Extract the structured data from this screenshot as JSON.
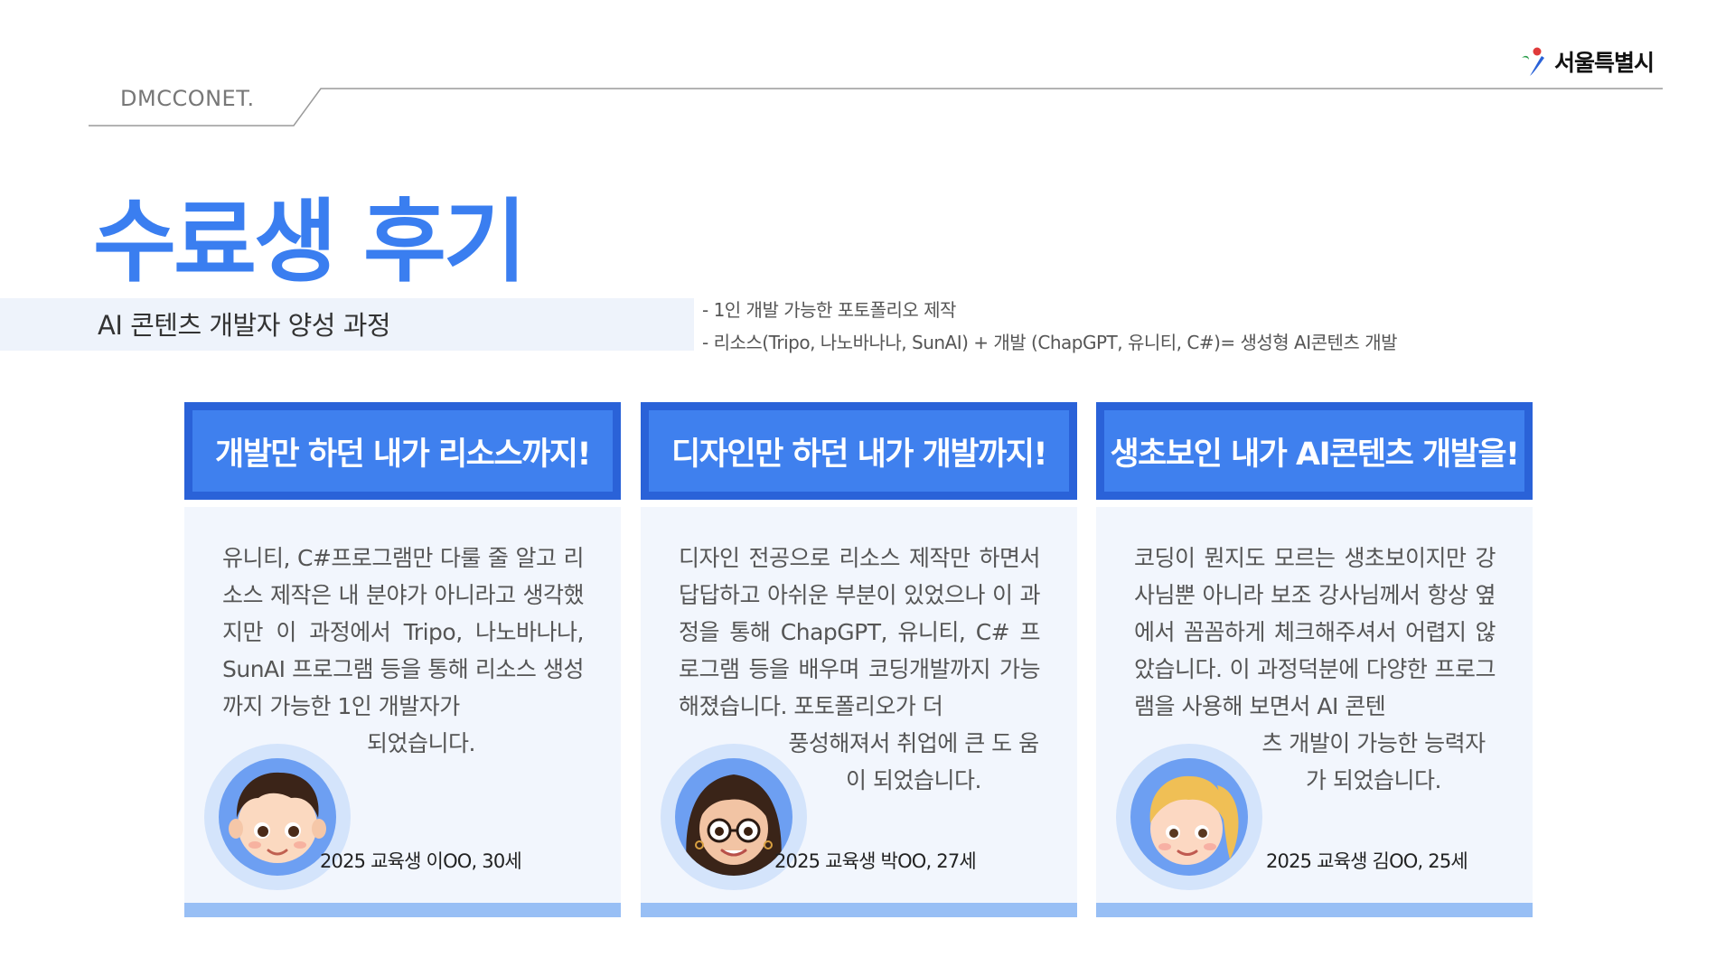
{
  "header": {
    "brand": "DMCCONET.",
    "logo_text": "서울특별시"
  },
  "title": "수료생 후기",
  "subtitle": "AI 콘텐츠 개발자 양성 과정",
  "description": [
    "- 1인 개발 가능한 포토폴리오 제작",
    "- 리소스(Tripo, 나노바나나, SunAI) + 개발 (ChapGPT, 유니티, C#)= 생성형 AI콘텐츠 개발"
  ],
  "cards": [
    {
      "heading": "개발만 하던 내가 리소스까지!",
      "review": "유니티, C#프로그램만 다룰 줄 알고 리소스 제작은 내 분야가 아니라고 생각했지만 이 과정에서 Tripo, 나노바나나, SunAI 프로그램 등을 통해 리소스 생성까지 가능한 1인 개발자가",
      "review_tail": "되었습니다.",
      "caption": "2025  교육생 이OO, 30세",
      "avatar": "boy-avatar-icon"
    },
    {
      "heading": "디자인만 하던 내가 개발까지!",
      "review": "디자인 전공으로 리소스 제작만 하면서 답답하고 아쉬운 부분이 있었으나 이 과정을 통해  ChapGPT, 유니티, C# 프로그램 등을 배우며 코딩개발까지 가능해졌습니다. 포토폴리오가 더",
      "review_tail": "풍성해져서 취업에 큰 도 움이 되었습니다.",
      "caption": "2025   교육생 박OO, 27세",
      "avatar": "woman-glasses-avatar-icon"
    },
    {
      "heading": "생초보인 내가 AI콘텐츠 개발을!",
      "review": "코딩이 뭔지도 모르는 생초보이지만 강사님뿐 아니라 보조 강사님께서 항상 옆에서 꼼꼼하게 체크해주셔서 어렵지 않았습니다. 이 과정덕분에 다양한 프로그램을 사용해 보면서 AI 콘텐",
      "review_tail": "츠 개발이 가능한 능력자 가 되었습니다.",
      "caption": "2025 교육생 김OO, 25세",
      "avatar": "blonde-girl-avatar-icon"
    }
  ],
  "colors": {
    "accent": "#3a7ef0",
    "card_border": "#2a62d8",
    "card_head": "#3f80ee",
    "card_body": "#f2f6fd",
    "card_foot": "#98bff5"
  }
}
